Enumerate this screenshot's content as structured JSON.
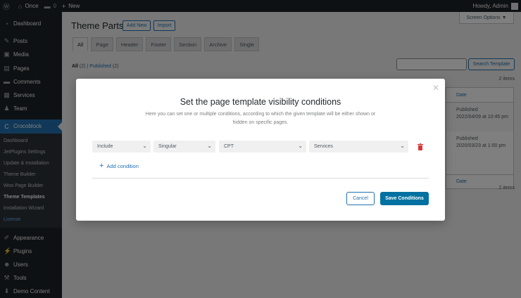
{
  "adminbar": {
    "site_name": "Once",
    "comments_count": "0",
    "new_label": "New",
    "howdy": "Howdy, Admin"
  },
  "menu": {
    "top_items": [
      {
        "label": "Dashboard",
        "icon": "dashboard-icon"
      },
      {
        "label": "Posts",
        "icon": "pin-icon"
      },
      {
        "label": "Media",
        "icon": "media-icon"
      },
      {
        "label": "Pages",
        "icon": "pages-icon"
      },
      {
        "label": "Comments",
        "icon": "comment-icon"
      },
      {
        "label": "Services",
        "icon": "services-icon"
      },
      {
        "label": "Team",
        "icon": "team-icon"
      }
    ],
    "active_item": "Crocoblock",
    "sub_items": [
      "Dashboard",
      "JetPlugins Settings",
      "Update & Installation",
      "Theme Builder",
      "Woo Page Builder",
      "Theme Templates",
      "Installation Wizard",
      "License"
    ],
    "bottom_items": [
      {
        "label": "Appearance",
        "icon": "appearance-icon"
      },
      {
        "label": "Plugins",
        "icon": "plugins-icon"
      },
      {
        "label": "Users",
        "icon": "users-icon"
      },
      {
        "label": "Tools",
        "icon": "tools-icon"
      },
      {
        "label": "Demo Content",
        "icon": "demo-content-icon"
      }
    ]
  },
  "page": {
    "title": "Theme Parts",
    "add_new": "Add New",
    "import": "Import",
    "screen_options": "Screen Options ▼",
    "tabs": [
      "All",
      "Page",
      "Header",
      "Footer",
      "Section",
      "Archive",
      "Single"
    ],
    "filter_all": "All",
    "filter_all_count": "(2)",
    "filter_sep": "|",
    "filter_published": "Published",
    "filter_published_count": "(2)",
    "search_button": "Search Template",
    "items_count": "2 items",
    "date_header": "Date",
    "rows": [
      {
        "status": "Published",
        "date": "2022/04/09 at 10:45 pm"
      },
      {
        "status": "Published",
        "date": "2020/03/23 at 1:00 pm"
      }
    ]
  },
  "modal": {
    "title": "Set the page template visibility conditions",
    "description": "Here you can set one or multiple conditions, according to which the given template will be either shown or hidden on specific pages.",
    "condition": {
      "include": "Include",
      "type": "Singular",
      "subtype": "CPT",
      "value": "Services"
    },
    "add_condition": "Add condition",
    "cancel": "Cancel",
    "save": "Save Conditions"
  }
}
